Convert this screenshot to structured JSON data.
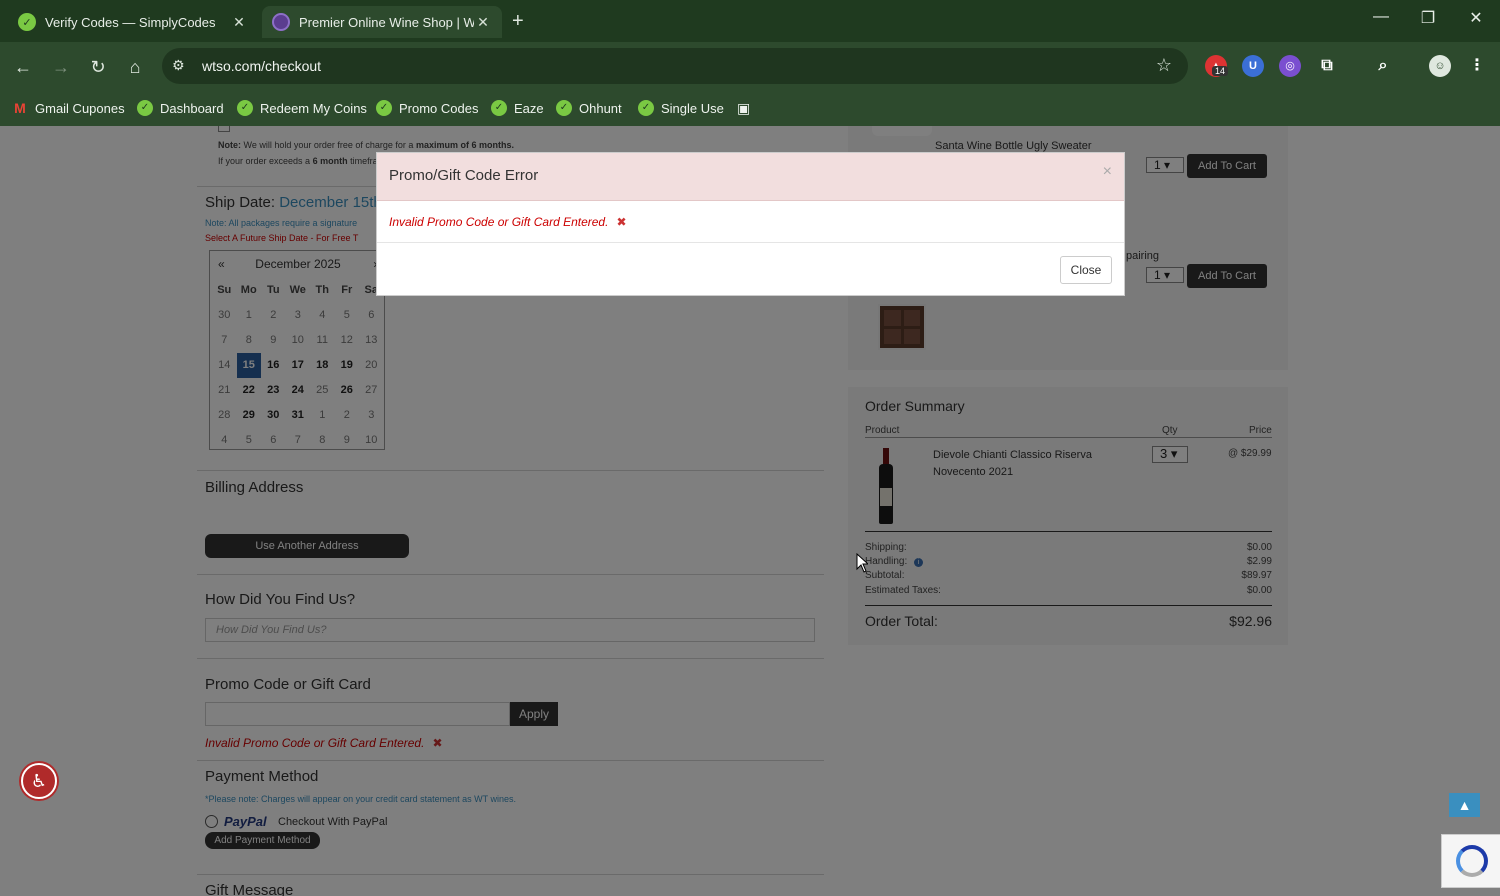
{
  "browser": {
    "tabs": [
      {
        "title": "Verify Codes — SimplyCodes",
        "active": false
      },
      {
        "title": "Premier Online Wine Shop | Wi",
        "active": true
      }
    ],
    "url": "wtso.com/checkout",
    "ext_badge": "14",
    "bookmarks": [
      "Gmail Cupones",
      "Dashboard",
      "Redeem My Coins",
      "Promo Codes",
      "Eaze",
      "Ohhunt",
      "Single Use"
    ]
  },
  "hold_note": {
    "note_label": "Note:",
    "note_text": "We will hold your order free of charge for a",
    "note_bold": "maximum of 6 months.",
    "line2_start": "If your order exceeds a",
    "line2_bold": "6 month",
    "line2_end": "timefra"
  },
  "ship": {
    "label": "Ship Date:",
    "date": "December 15th",
    "note1": "Note: All packages require a signature",
    "note2": "Select A Future Ship Date - For Free T"
  },
  "calendar": {
    "prev": "«",
    "next": "»",
    "month": "December 2025",
    "days_of_week": [
      "Su",
      "Mo",
      "Tu",
      "We",
      "Th",
      "Fr",
      "Sa"
    ],
    "weeks": [
      [
        "30",
        "1",
        "2",
        "3",
        "4",
        "5",
        "6"
      ],
      [
        "7",
        "8",
        "9",
        "10",
        "11",
        "12",
        "13"
      ],
      [
        "14",
        "15",
        "16",
        "17",
        "18",
        "19",
        "20"
      ],
      [
        "21",
        "22",
        "23",
        "24",
        "25",
        "26",
        "27"
      ],
      [
        "28",
        "29",
        "30",
        "31",
        "1",
        "2",
        "3"
      ],
      [
        "4",
        "5",
        "6",
        "7",
        "8",
        "9",
        "10"
      ]
    ],
    "selected": "15"
  },
  "billing": {
    "title": "Billing Address",
    "button": "Use Another Address"
  },
  "find_us": {
    "title": "How Did You Find Us?",
    "placeholder": "How Did You Find Us?"
  },
  "promo": {
    "title": "Promo Code or Gift Card",
    "value": "",
    "apply": "Apply",
    "error": "Invalid Promo Code or Gift Card Entered.",
    "error_mark": "✖"
  },
  "payment": {
    "title": "Payment Method",
    "note": "*Please note: Charges will appear on your credit card statement as WT wines.",
    "paypal_logo": "PayPal",
    "paypal_text": "Checkout With PayPal",
    "add_method": "Add Payment Method"
  },
  "gift": {
    "title": "Gift Message"
  },
  "upsell": [
    {
      "name": "Santa Wine Bottle Ugly Sweater",
      "qty": "1",
      "button": "Add To Cart"
    },
    {
      "name": "pairing",
      "qty": "1",
      "button": "Add To Cart"
    }
  ],
  "order_summary": {
    "title": "Order Summary",
    "col_product": "Product",
    "col_qty": "Qty",
    "col_price": "Price",
    "item_name": "Dievole Chianti Classico Riserva Novecento 2021",
    "item_qty": "3",
    "item_price": "@ $29.99",
    "shipping_label": "Shipping:",
    "shipping_val": "$0.00",
    "handling_label": "Handling:",
    "handling_val": "$2.99",
    "subtotal_label": "Subtotal:",
    "subtotal_val": "$89.97",
    "tax_label": "Estimated Taxes:",
    "tax_val": "$0.00",
    "total_label": "Order Total:",
    "total_val": "$92.96"
  },
  "modal": {
    "title": "Promo/Gift Code Error",
    "close_x": "×",
    "message": "Invalid Promo Code or Gift Card Entered.",
    "message_mark": "✖",
    "close_button": "Close"
  },
  "colors": {
    "browser_dark": "#1f3a1f",
    "browser_bar": "#2d4a2d",
    "error_red": "#cc0000",
    "modal_header": "#f2dede",
    "link_blue": "#3a8fbf"
  }
}
